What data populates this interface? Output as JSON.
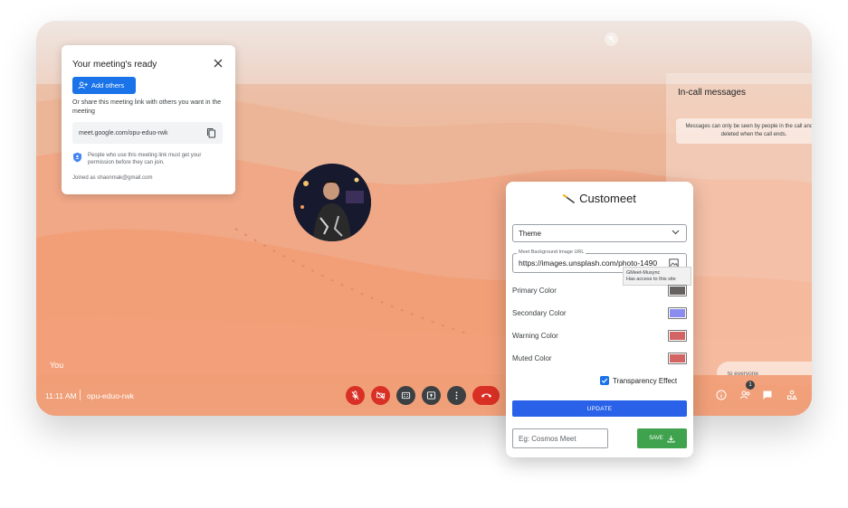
{
  "meet": {
    "you_label": "You",
    "time": "11:11 AM",
    "meeting_code": "opu-eduo-rwk",
    "people_count": "1"
  },
  "ready_card": {
    "title": "Your meeting's ready",
    "add_others_label": "Add others",
    "share_text": "Or share this meeting link with others you want in the meeting",
    "meeting_link": "meet.google.com/opu-eduo-rwk",
    "permission_note": "People who use this meeting link must get your permission before they can join.",
    "joined_as": "Joined as shaonmak@gmail.com"
  },
  "messages_panel": {
    "title": "In-call messages",
    "note": "Messages can only be seen by people in the call and are deleted when the call ends.",
    "send_placeholder": "to everyone"
  },
  "customeet": {
    "title": "Customeet",
    "theme_label": "Theme",
    "bg_url_legend": "Meet Background Image URL",
    "bg_url_value": "https://images.unsplash.com/photo-1490",
    "tooltip_line1": "GMeet-Musync",
    "tooltip_line2": "Has access to this site",
    "colors": [
      {
        "label": "Primary Color",
        "value": "#666262"
      },
      {
        "label": "Secondary Color",
        "value": "#8a8cf0"
      },
      {
        "label": "Warning Color",
        "value": "#d26464"
      },
      {
        "label": "Muted Color",
        "value": "#d26464"
      }
    ],
    "transparency_label": "Transparency Effect",
    "transparency_checked": true,
    "update_label": "UPDATE",
    "name_placeholder": "Eg: Cosmos Meet",
    "save_label": "SAVE"
  },
  "colors": {
    "accent_blue": "#1a73e8",
    "end_call_red": "#d93025",
    "save_green": "#3fa34d"
  }
}
